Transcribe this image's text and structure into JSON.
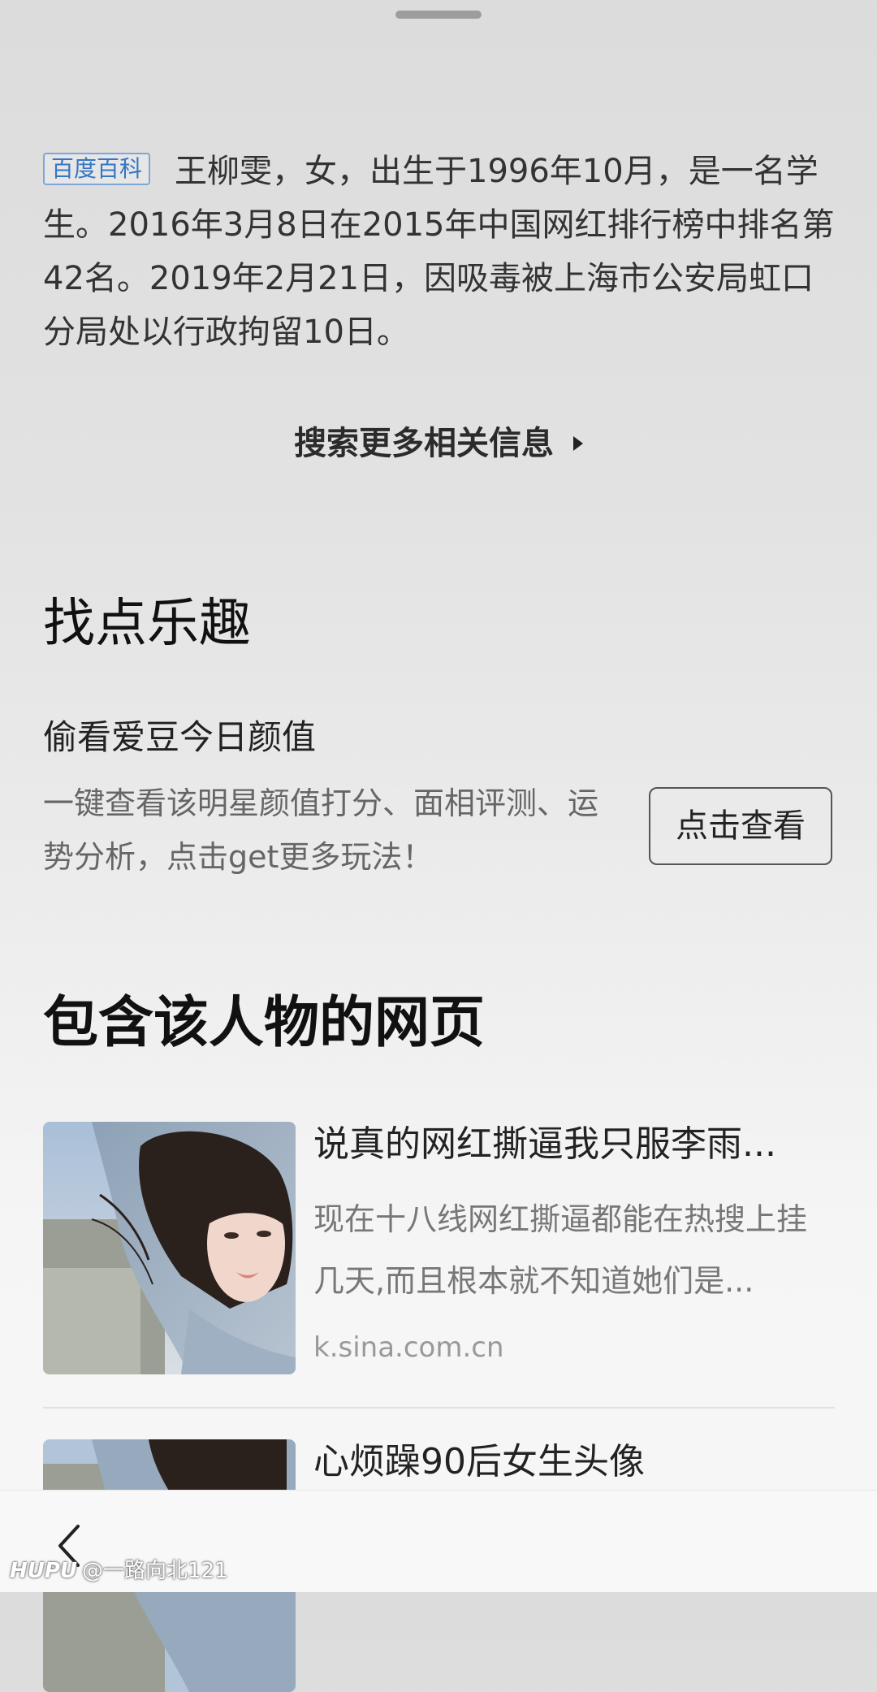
{
  "baike": {
    "badge": "百度百科",
    "text": "王柳雯，女，出生于1996年10月，是一名学生。2016年3月8日在2015年中国网红排行榜中排名第42名。2019年2月21日，因吸毒被上海市公安局虹口分局处以行政拘留10日。"
  },
  "more_info": {
    "label": "搜索更多相关信息"
  },
  "fun_section": {
    "title": "找点乐趣",
    "subtitle": "偷看爱豆今日颜值",
    "description": "一键查看该明星颜值打分、面相评测、运势分析，点击get更多玩法！",
    "button_label": "点击查看"
  },
  "web_section": {
    "title": "包含该人物的网页",
    "cards": [
      {
        "title": "说真的网红撕逼我只服李雨...",
        "summary": "现在十八线网红撕逼都能在热搜上挂几天,而且根本就不知道她们是...",
        "source": "k.sina.com.cn"
      },
      {
        "title": "心烦躁90后女生头像"
      }
    ]
  },
  "bottom_bar": {
    "back_icon": "chevron-left-icon"
  },
  "watermark": {
    "brand": "HUPU",
    "handle": "@一路向北121"
  },
  "colors": {
    "badge_blue": "#3676c4",
    "body_text": "#333333",
    "muted_text": "#777777"
  }
}
